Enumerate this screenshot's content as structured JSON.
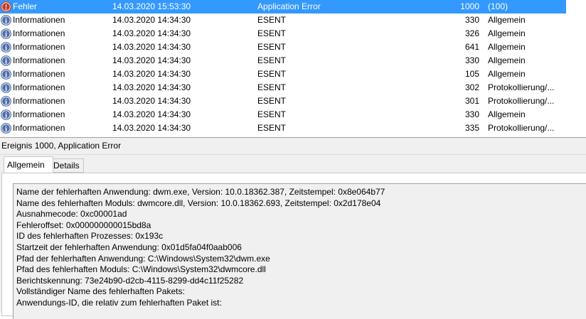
{
  "event_list": {
    "rows": [
      {
        "level": "Fehler",
        "date": "14.03.2020 15:53:30",
        "source": "Application Error",
        "event_id": "1000",
        "category": "(100)",
        "icon": "error-icon",
        "selected": true
      },
      {
        "level": "Informationen",
        "date": "14.03.2020 14:34:30",
        "source": "ESENT",
        "event_id": "330",
        "category": "Allgemein",
        "icon": "info-icon",
        "selected": false
      },
      {
        "level": "Informationen",
        "date": "14.03.2020 14:34:30",
        "source": "ESENT",
        "event_id": "326",
        "category": "Allgemein",
        "icon": "info-icon",
        "selected": false
      },
      {
        "level": "Informationen",
        "date": "14.03.2020 14:34:30",
        "source": "ESENT",
        "event_id": "641",
        "category": "Allgemein",
        "icon": "info-icon",
        "selected": false
      },
      {
        "level": "Informationen",
        "date": "14.03.2020 14:34:30",
        "source": "ESENT",
        "event_id": "330",
        "category": "Allgemein",
        "icon": "info-icon",
        "selected": false
      },
      {
        "level": "Informationen",
        "date": "14.03.2020 14:34:30",
        "source": "ESENT",
        "event_id": "105",
        "category": "Allgemein",
        "icon": "info-icon",
        "selected": false
      },
      {
        "level": "Informationen",
        "date": "14.03.2020 14:34:30",
        "source": "ESENT",
        "event_id": "302",
        "category": "Protokollierung/...",
        "icon": "info-icon",
        "selected": false
      },
      {
        "level": "Informationen",
        "date": "14.03.2020 14:34:30",
        "source": "ESENT",
        "event_id": "301",
        "category": "Protokollierung/...",
        "icon": "info-icon",
        "selected": false
      },
      {
        "level": "Informationen",
        "date": "14.03.2020 14:34:30",
        "source": "ESENT",
        "event_id": "330",
        "category": "Allgemein",
        "icon": "info-icon",
        "selected": false
      },
      {
        "level": "Informationen",
        "date": "14.03.2020 14:34:30",
        "source": "ESENT",
        "event_id": "335",
        "category": "Protokollierung/...",
        "icon": "info-icon",
        "selected": false
      }
    ]
  },
  "details": {
    "header": "Ereignis 1000, Application Error",
    "tabs": [
      {
        "label": "Allgemein",
        "active": true
      },
      {
        "label": "Details",
        "active": false
      }
    ],
    "message_lines": [
      "Name der fehlerhaften Anwendung: dwm.exe, Version: 10.0.18362.387, Zeitstempel: 0x8e064b77",
      "Name des fehlerhaften Moduls: dwmcore.dll, Version: 10.0.18362.693, Zeitstempel: 0x2d178e04",
      "Ausnahmecode: 0xc00001ad",
      "Fehleroffset: 0x000000000015bd8a",
      "ID des fehlerhaften Prozesses: 0x193c",
      "Startzeit der fehlerhaften Anwendung: 0x01d5fa04f0aab006",
      "Pfad der fehlerhaften Anwendung: C:\\Windows\\System32\\dwm.exe",
      "Pfad des fehlerhaften Moduls: C:\\Windows\\System32\\dwmcore.dll",
      "Berichtskennung: 73e24b90-d2cb-4115-8299-dd4c11f25282",
      "Vollständiger Name des fehlerhaften Pakets:",
      "Anwendungs-ID, die relativ zum fehlerhaften Paket ist:"
    ]
  },
  "colors": {
    "selection": "#3399ff",
    "info_icon": "#4f6fa8",
    "error_icon": "#c0392b",
    "pane_background": "#f0f0f0"
  }
}
